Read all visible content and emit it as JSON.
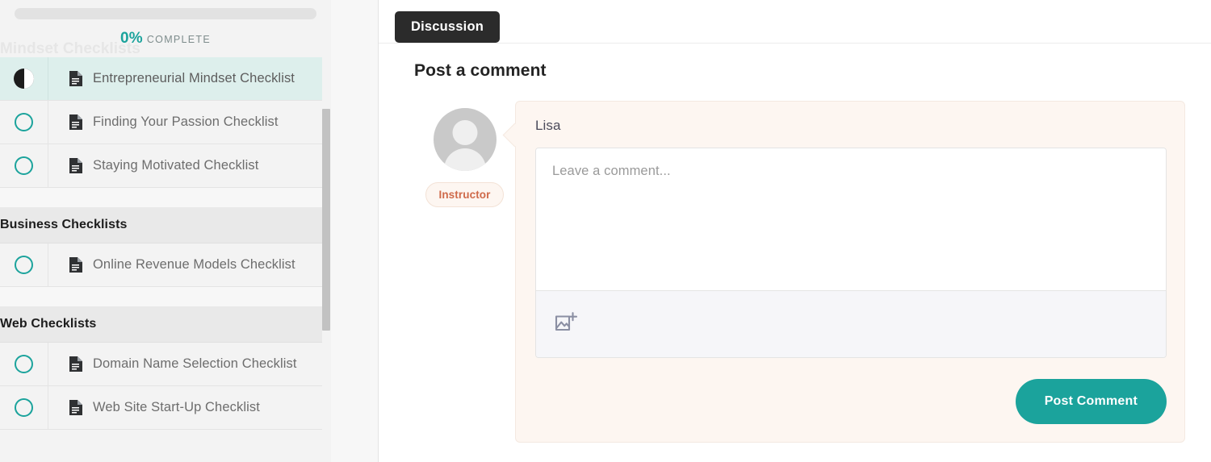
{
  "sidebar": {
    "progress": {
      "percent_label": "0%",
      "complete_label": "COMPLETE",
      "value": 0,
      "accent_color": "#1ba39c"
    },
    "ghost_section_title": "Mindset Checklists",
    "sections": [
      {
        "title": "",
        "show_header": false,
        "items": [
          {
            "label": "Entrepreneurial Mindset Checklist",
            "status": "in-progress",
            "active": true
          },
          {
            "label": "Finding Your Passion Checklist",
            "status": "incomplete",
            "active": false
          },
          {
            "label": "Staying Motivated Checklist",
            "status": "incomplete",
            "active": false
          }
        ]
      },
      {
        "title": "Business Checklists",
        "show_header": true,
        "items": [
          {
            "label": "Online Revenue Models Checklist",
            "status": "incomplete",
            "active": false
          }
        ]
      },
      {
        "title": "Web Checklists",
        "show_header": true,
        "items": [
          {
            "label": "Domain Name Selection Checklist",
            "status": "incomplete",
            "active": false
          },
          {
            "label": "Web Site Start-Up Checklist",
            "status": "incomplete",
            "active": false
          }
        ]
      }
    ]
  },
  "main": {
    "tab_label": "Discussion",
    "post_title": "Post a comment",
    "commenter": {
      "name": "Lisa",
      "badge": "Instructor",
      "badge_color": "#cf6a4a",
      "avatar_icon": "user-avatar-icon"
    },
    "editor": {
      "placeholder": "Leave a comment...",
      "value": "",
      "toolbar_icon": "add-image-icon"
    },
    "submit_label": "Post Comment",
    "submit_color": "#1ba39c"
  }
}
